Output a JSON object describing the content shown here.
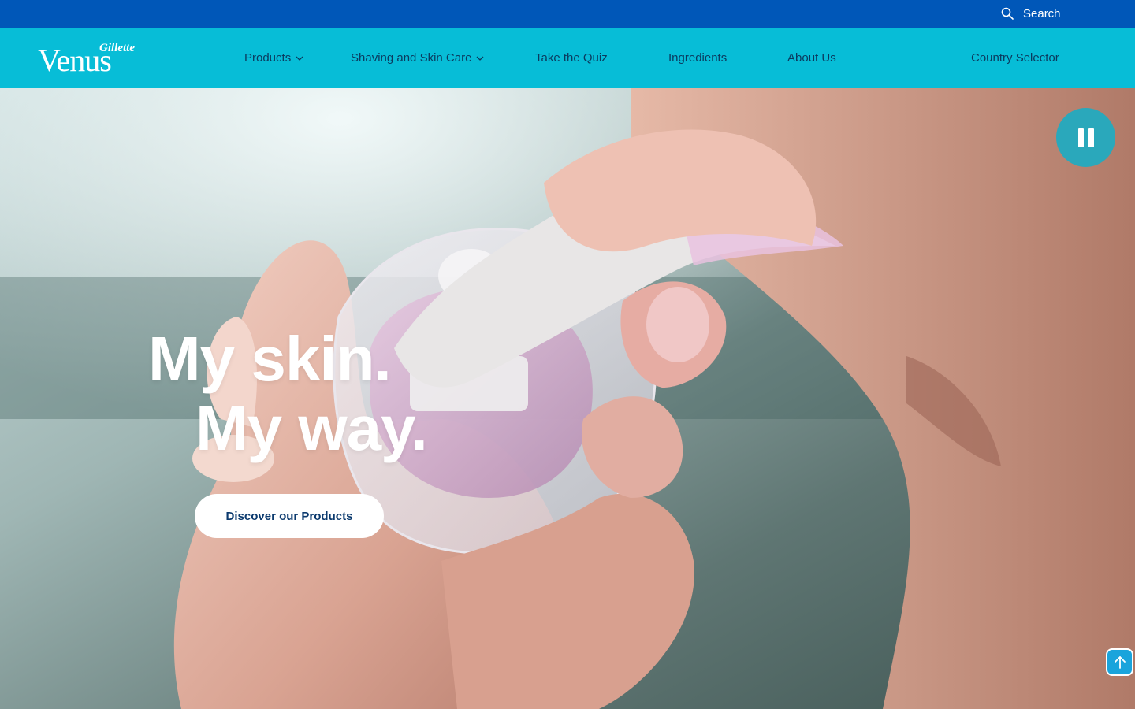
{
  "utility_bar": {
    "search_label": "Search",
    "search_icon": "search-icon",
    "background_color": "#0057b8"
  },
  "brand": {
    "logo_top": "Gillette",
    "logo_main": "Venus"
  },
  "nav": {
    "background_color": "#07bdd7",
    "items": [
      {
        "label": "Products",
        "has_dropdown": true
      },
      {
        "label": "Shaving and Skin Care",
        "has_dropdown": true
      },
      {
        "label": "Take the Quiz",
        "has_dropdown": false
      },
      {
        "label": "Ingredients",
        "has_dropdown": false
      },
      {
        "label": "About Us",
        "has_dropdown": false
      }
    ],
    "country_selector": "Country Selector"
  },
  "hero": {
    "headline_line1": "My skin.",
    "headline_line2": "My way.",
    "cta_label": "Discover our Products",
    "pause_icon": "pause-icon",
    "scroll_top_icon": "arrow-up-icon",
    "accent_color": "#2aa8bb"
  }
}
